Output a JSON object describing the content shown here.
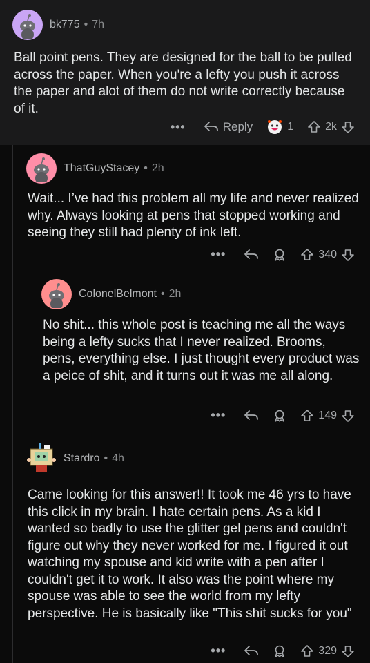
{
  "comments": [
    {
      "user": "bk775",
      "time": "7h",
      "text": "Ball point pens. They are designed for the ball to be pulled across the paper. When you're a lefty you push it across the paper and alot of them do not write correctly because of it.",
      "reply_label": "Reply",
      "award_count": "1",
      "votes": "2k",
      "avatar_color": "#c9a5f5"
    },
    {
      "user": "ThatGuyStacey",
      "time": "2h",
      "text": "Wait... I’ve had this problem all my life and never realized why. Always looking at pens that stopped working and seeing they still had plenty of ink left.",
      "votes": "340",
      "avatar_color": "#ff8ea8"
    },
    {
      "user": "ColonelBelmont",
      "time": "2h",
      "text": "No shit... this whole post is teaching me all the ways being a lefty sucks that I never realized. Brooms, pens, everything else. I just thought every product was a peice of shit, and it turns out it was me all along.",
      "votes": "149",
      "avatar_color": "#ff8e8e"
    },
    {
      "user": "Stardro",
      "time": "4h",
      "text": "Came looking for this answer!! It took me 46 yrs to have this click in my brain. I hate certain pens. As a kid I wanted so badly to use the glitter gel pens and couldn't figure out why they never worked for me. I figured it out watching my spouse and kid write with a pen after I couldn't get it to work. It also was the point where my spouse was able to see the world from my lefty perspective. He is basically like \"This shit sucks for you\"",
      "votes": "329"
    }
  ],
  "ui": {
    "dot": "•",
    "more": "•••"
  }
}
